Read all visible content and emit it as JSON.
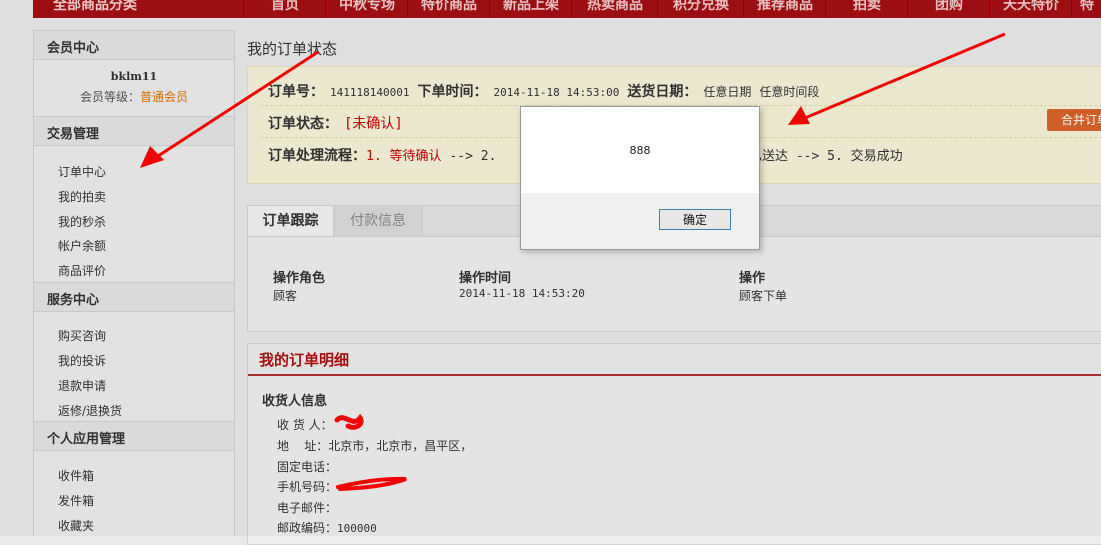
{
  "top_nav": {
    "category_label": "全部商品分类",
    "items": [
      "首页",
      "中秋专场",
      "特价商品",
      "新品上架",
      "热卖商品",
      "积分兑换",
      "推荐商品",
      "拍卖",
      "团购",
      "天天特价",
      "特"
    ]
  },
  "sidebar": {
    "member_center": "会员中心",
    "username": "bklm11",
    "level_label": "会员等级：",
    "level_value": "普通会员",
    "trade": {
      "title": "交易管理",
      "items": [
        "订单中心",
        "我的拍卖",
        "我的秒杀",
        "帐户余额",
        "商品评价"
      ]
    },
    "service": {
      "title": "服务中心",
      "items": [
        "购买咨询",
        "我的投诉",
        "退款申请",
        "返修/退换货"
      ]
    },
    "personal": {
      "title": "个人应用管理",
      "items": [
        "收件箱",
        "发件箱",
        "收藏夹"
      ]
    }
  },
  "order_status": {
    "title": "我的订单状态",
    "order_no_label": "订单号：",
    "order_no": "141118140001",
    "order_time_label": "下单时间：",
    "order_time": "2014-11-18 14:53:00",
    "delivery_label": "送货日期：",
    "delivery_date": "任意日期",
    "delivery_slot": "任意时间段",
    "status_label": "订单状态：",
    "status_value": "[未确认]",
    "merge_button": "合并订单",
    "flow_label": "订单处理流程：",
    "flow_step1": "1. 等待确认",
    "flow_mid": "--> 2.",
    "flow_end": "已送达 --> 5. 交易成功"
  },
  "tracking": {
    "tabs": [
      "订单跟踪",
      "付款信息"
    ],
    "headers": [
      "操作角色",
      "操作时间",
      "操作"
    ],
    "row": [
      "顾客",
      "2014-11-18 14:53:20",
      "顾客下单"
    ]
  },
  "detail": {
    "title": "我的订单明细",
    "receiver_title": "收货人信息",
    "rows": [
      {
        "label": "收 货 人：",
        "value": ""
      },
      {
        "label": "地    址：",
        "value": "北京市，北京市，昌平区，"
      },
      {
        "label": "固定电话：",
        "value": ""
      },
      {
        "label": "手机号码：",
        "value": ""
      },
      {
        "label": "电子邮件：",
        "value": ""
      },
      {
        "label": "邮政编码：",
        "value": "100000"
      }
    ]
  },
  "dialog": {
    "message": "888",
    "ok_button": "确定"
  },
  "colors": {
    "nav_red": "#a30f12",
    "accent_orange": "#e07000",
    "status_red": "#cc0000",
    "annotation_red": "#ff0000"
  }
}
